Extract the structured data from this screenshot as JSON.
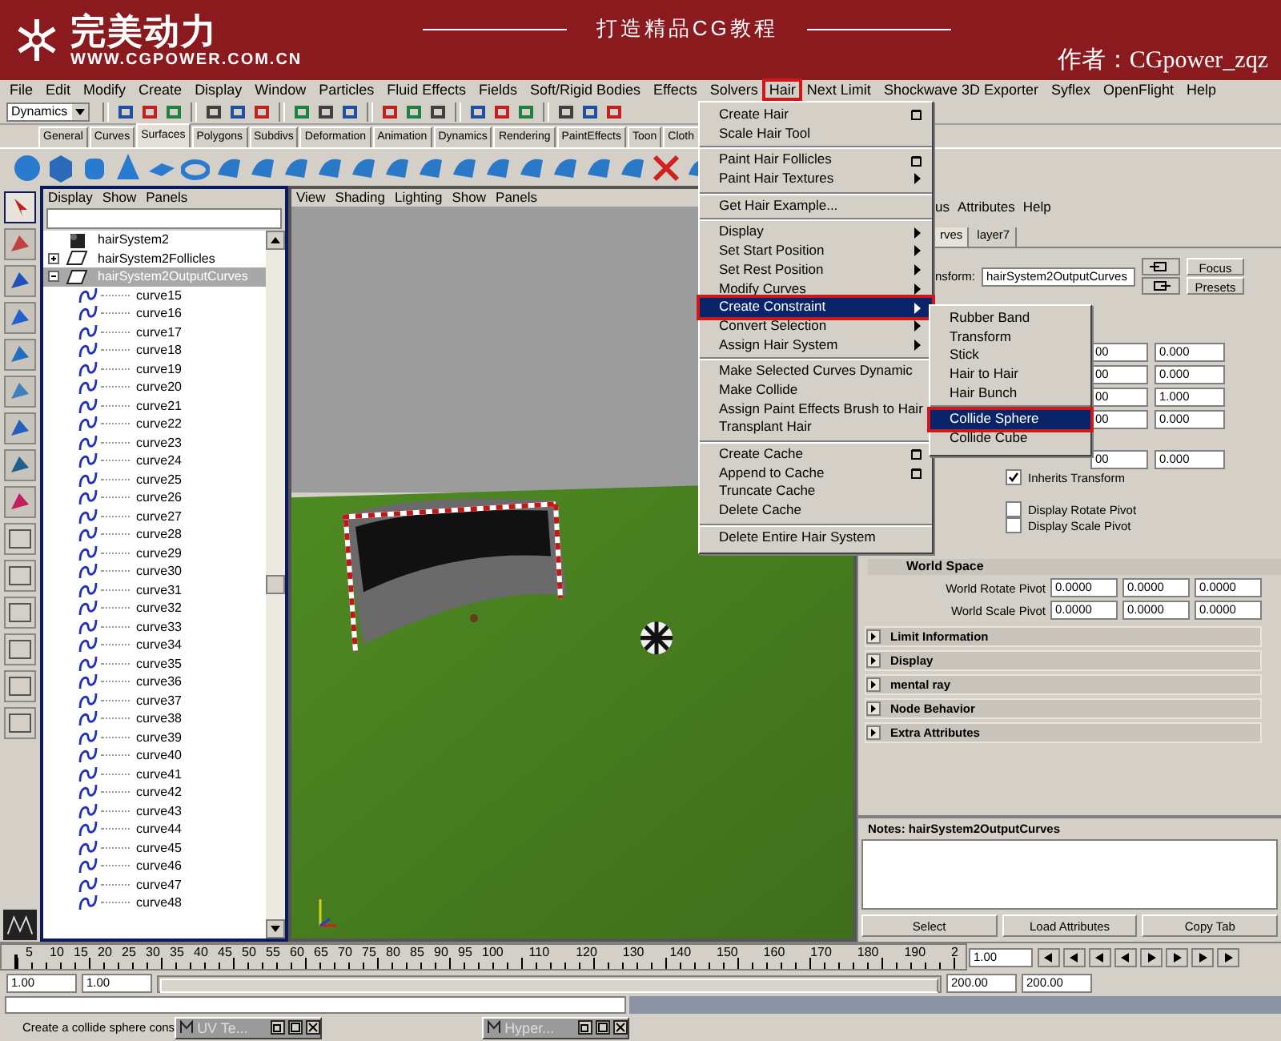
{
  "banner": {
    "logo_text": "完美动力",
    "url": "WWW.CGPOWER.COM.CN",
    "slogan": "打造精品CG教程",
    "author": "作者：CGpower_zqz"
  },
  "menubar": [
    {
      "label": "File",
      "selected": false
    },
    {
      "label": "Edit",
      "selected": false
    },
    {
      "label": "Modify",
      "selected": false
    },
    {
      "label": "Create",
      "selected": false
    },
    {
      "label": "Display",
      "selected": false
    },
    {
      "label": "Window",
      "selected": false
    },
    {
      "label": "Particles",
      "selected": false
    },
    {
      "label": "Fluid Effects",
      "selected": false
    },
    {
      "label": "Fields",
      "selected": false
    },
    {
      "label": "Soft/Rigid Bodies",
      "selected": false
    },
    {
      "label": "Effects",
      "selected": false
    },
    {
      "label": "Solvers",
      "selected": false
    },
    {
      "label": "Hair",
      "selected": true
    },
    {
      "label": "Next Limit",
      "selected": false
    },
    {
      "label": "Shockwave 3D Exporter",
      "selected": false
    },
    {
      "label": "Syflex",
      "selected": false
    },
    {
      "label": "OpenFlight",
      "selected": false
    },
    {
      "label": "Help",
      "selected": false
    }
  ],
  "status_line": {
    "mode": "Dynamics"
  },
  "shelf_tabs": [
    {
      "label": "General",
      "selected": false
    },
    {
      "label": "Curves",
      "selected": false
    },
    {
      "label": "Surfaces",
      "selected": true
    },
    {
      "label": "Polygons",
      "selected": false
    },
    {
      "label": "Subdivs",
      "selected": false
    },
    {
      "label": "Deformation",
      "selected": false
    },
    {
      "label": "Animation",
      "selected": false
    },
    {
      "label": "Dynamics",
      "selected": false
    },
    {
      "label": "Rendering",
      "selected": false
    },
    {
      "label": "PaintEffects",
      "selected": false
    },
    {
      "label": "Toon",
      "selected": false
    },
    {
      "label": "Cloth",
      "selected": false
    }
  ],
  "hair_menu": {
    "groups": [
      {
        "items": [
          {
            "label": "Create Hair",
            "kind": "option",
            "selected": false
          },
          {
            "label": "Scale Hair Tool",
            "kind": "plain",
            "selected": false
          }
        ]
      },
      {
        "items": [
          {
            "label": "Paint Hair Follicles",
            "kind": "option",
            "selected": false
          },
          {
            "label": "Paint Hair Textures",
            "kind": "submenu",
            "selected": false
          }
        ]
      },
      {
        "items": [
          {
            "label": "Get Hair Example...",
            "kind": "plain",
            "selected": false
          }
        ]
      },
      {
        "items": [
          {
            "label": "Display",
            "kind": "submenu",
            "selected": false
          },
          {
            "label": "Set Start Position",
            "kind": "submenu",
            "selected": false
          },
          {
            "label": "Set Rest Position",
            "kind": "submenu",
            "selected": false
          },
          {
            "label": "Modify Curves",
            "kind": "submenu",
            "selected": false
          },
          {
            "label": "Create Constraint",
            "kind": "submenu",
            "selected": true
          },
          {
            "label": "Convert Selection",
            "kind": "submenu",
            "selected": false
          },
          {
            "label": "Assign Hair System",
            "kind": "submenu",
            "selected": false
          }
        ]
      },
      {
        "items": [
          {
            "label": "Make Selected Curves Dynamic",
            "kind": "plain",
            "selected": false
          },
          {
            "label": "Make Collide",
            "kind": "plain",
            "selected": false
          },
          {
            "label": "Assign Paint Effects Brush to Hair",
            "kind": "plain",
            "selected": false
          },
          {
            "label": "Transplant Hair",
            "kind": "plain",
            "selected": false
          }
        ]
      },
      {
        "items": [
          {
            "label": "Create Cache",
            "kind": "option",
            "selected": false
          },
          {
            "label": "Append to Cache",
            "kind": "option",
            "selected": false
          },
          {
            "label": "Truncate Cache",
            "kind": "plain",
            "selected": false
          },
          {
            "label": "Delete Cache",
            "kind": "plain",
            "selected": false
          }
        ]
      },
      {
        "items": [
          {
            "label": "Delete Entire Hair System",
            "kind": "plain",
            "selected": false
          }
        ]
      }
    ]
  },
  "constraint_submenu": {
    "groups": [
      {
        "items": [
          {
            "label": "Rubber Band",
            "selected": false
          },
          {
            "label": "Transform",
            "selected": false
          },
          {
            "label": "Stick",
            "selected": false
          },
          {
            "label": "Hair to Hair",
            "selected": false
          },
          {
            "label": "Hair Bunch",
            "selected": false
          }
        ]
      },
      {
        "items": [
          {
            "label": "Collide Sphere",
            "selected": true
          },
          {
            "label": "Collide Cube",
            "selected": false
          }
        ]
      }
    ]
  },
  "outliner": {
    "menu": [
      "Display",
      "Show",
      "Panels"
    ],
    "items": [
      {
        "label": "hairSystem2",
        "kind": "hair_system",
        "selected": false
      },
      {
        "label": "hairSystem2Follicles",
        "kind": "transform",
        "selected": false,
        "expanded": false
      },
      {
        "label": "hairSystem2OutputCurves",
        "kind": "transform",
        "selected": true,
        "expanded": true,
        "children": [
          {
            "label": "curve15",
            "kind": "curve",
            "selected": false
          },
          {
            "label": "curve16",
            "kind": "curve",
            "selected": false
          },
          {
            "label": "curve17",
            "kind": "curve",
            "selected": false
          },
          {
            "label": "curve18",
            "kind": "curve",
            "selected": false
          },
          {
            "label": "curve19",
            "kind": "curve",
            "selected": false
          },
          {
            "label": "curve20",
            "kind": "curve",
            "selected": false
          },
          {
            "label": "curve21",
            "kind": "curve",
            "selected": false
          },
          {
            "label": "curve22",
            "kind": "curve",
            "selected": false
          },
          {
            "label": "curve23",
            "kind": "curve",
            "selected": false
          },
          {
            "label": "curve24",
            "kind": "curve",
            "selected": false
          },
          {
            "label": "curve25",
            "kind": "curve",
            "selected": false
          },
          {
            "label": "curve26",
            "kind": "curve",
            "selected": false
          },
          {
            "label": "curve27",
            "kind": "curve",
            "selected": false
          },
          {
            "label": "curve28",
            "kind": "curve",
            "selected": false
          },
          {
            "label": "curve29",
            "kind": "curve",
            "selected": false
          },
          {
            "label": "curve30",
            "kind": "curve",
            "selected": false
          },
          {
            "label": "curve31",
            "kind": "curve",
            "selected": false
          },
          {
            "label": "curve32",
            "kind": "curve",
            "selected": false
          },
          {
            "label": "curve33",
            "kind": "curve",
            "selected": false
          },
          {
            "label": "curve34",
            "kind": "curve",
            "selected": false
          },
          {
            "label": "curve35",
            "kind": "curve",
            "selected": false
          },
          {
            "label": "curve36",
            "kind": "curve",
            "selected": false
          },
          {
            "label": "curve37",
            "kind": "curve",
            "selected": false
          },
          {
            "label": "curve38",
            "kind": "curve",
            "selected": false
          },
          {
            "label": "curve39",
            "kind": "curve",
            "selected": false
          },
          {
            "label": "curve40",
            "kind": "curve",
            "selected": false
          },
          {
            "label": "curve41",
            "kind": "curve",
            "selected": false
          },
          {
            "label": "curve42",
            "kind": "curve",
            "selected": false
          },
          {
            "label": "curve43",
            "kind": "curve",
            "selected": false
          },
          {
            "label": "curve44",
            "kind": "curve",
            "selected": false
          },
          {
            "label": "curve45",
            "kind": "curve",
            "selected": false
          },
          {
            "label": "curve46",
            "kind": "curve",
            "selected": false
          },
          {
            "label": "curve47",
            "kind": "curve",
            "selected": false
          },
          {
            "label": "curve48",
            "kind": "curve",
            "selected": false
          }
        ]
      }
    ]
  },
  "viewport": {
    "menu": [
      "View",
      "Shading",
      "Lighting",
      "Show",
      "Panels"
    ]
  },
  "attribute_editor": {
    "menu": [
      "us",
      "Attributes",
      "Help"
    ],
    "tabs": [
      {
        "label": "rves",
        "selected": true
      },
      {
        "label": "layer7",
        "selected": false
      }
    ],
    "transform_label": "nsform:",
    "transform_value": "hairSystem2OutputCurves",
    "buttons": [
      "Focus",
      "Presets"
    ],
    "vector_rows": [
      {
        "column_2": "00",
        "column_3": "0.000"
      },
      {
        "column_2": "00",
        "column_3": "0.000"
      },
      {
        "column_2": "00",
        "column_3": "1.000"
      },
      {
        "column_2": "00",
        "column_3": "0.000"
      }
    ],
    "pivot_row": {
      "column_2": "00",
      "column_3": "0.000"
    },
    "checkboxes": [
      {
        "label": "Inherits Transform",
        "checked": true
      },
      {
        "label": "Display Rotate Pivot",
        "checked": false
      },
      {
        "label": "Display Scale Pivot",
        "checked": false
      }
    ],
    "world_space": {
      "title": "World Space",
      "rows": [
        {
          "label": "World Rotate Pivot",
          "values": [
            "0.0000",
            "0.0000",
            "0.0000"
          ]
        },
        {
          "label": "World Scale Pivot",
          "values": [
            "0.0000",
            "0.0000",
            "0.0000"
          ]
        }
      ]
    },
    "sections": [
      "Limit Information",
      "Display",
      "mental ray",
      "Node Behavior",
      "Extra Attributes"
    ],
    "notes_title": "Notes: hairSystem2OutputCurves",
    "bottom_buttons": [
      "Select",
      "Load Attributes",
      "Copy Tab"
    ]
  },
  "timeline": {
    "ticks": [
      "5",
      "10",
      "15",
      "20",
      "25",
      "30",
      "35",
      "40",
      "45",
      "50",
      "55",
      "60",
      "65",
      "70",
      "75",
      "80",
      "85",
      "90",
      "95",
      "100",
      "110",
      "120",
      "130",
      "140",
      "150",
      "160",
      "170",
      "180",
      "190",
      "2"
    ],
    "current_frame": "1.00",
    "level": 0
  },
  "range": {
    "level": 1,
    "start": "1.00",
    "playback_start": "1.00",
    "playback_end": "200.00",
    "end": "200.00"
  },
  "help_line": "Create a collide sphere cons",
  "taskbar": [
    {
      "label": "UV Te..."
    },
    {
      "label": "Hyper..."
    }
  ]
}
